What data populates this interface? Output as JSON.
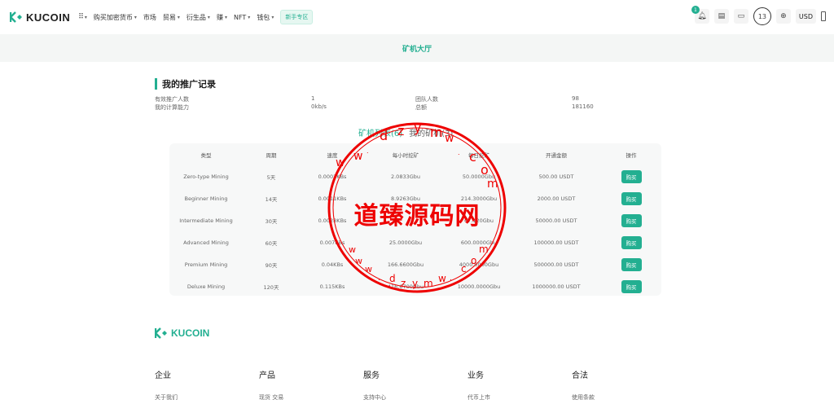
{
  "header": {
    "logo_text": "KUCOIN",
    "nav": [
      {
        "label": "购买加密货币",
        "dropdown": true
      },
      {
        "label": "市场",
        "dropdown": false
      },
      {
        "label": "贸易",
        "dropdown": true
      },
      {
        "label": "衍生品",
        "dropdown": true
      },
      {
        "label": "赚",
        "dropdown": true
      },
      {
        "label": "NFT",
        "dropdown": true
      },
      {
        "label": "钱包",
        "dropdown": true
      }
    ],
    "new_user_badge": "新手专区",
    "notification_count": "1",
    "profile_number": "13",
    "currency": "USD"
  },
  "page_title": "矿机大厅",
  "records": {
    "title": "我的推广记录",
    "stats": [
      {
        "label": "有效推广人数",
        "value": "1",
        "label2": "团队人数",
        "value2": "98"
      },
      {
        "label": "我的计算能力",
        "value": "0kb/s",
        "label2": "总额",
        "value2": "181160"
      }
    ]
  },
  "tabs": {
    "active": "矿机列表(6)",
    "inactive": "我的矿机(3)"
  },
  "table": {
    "headers": [
      "类型",
      "周期",
      "速度",
      "每小时挖矿",
      "每日挖矿",
      "开通金额",
      "操作"
    ],
    "rows": [
      [
        "Zero-type Mining",
        "5天",
        "0.0002KBs",
        "2.0833Gbu",
        "50.0000Gbu",
        "500.00 USDT",
        "购买"
      ],
      [
        "Beginner Mining",
        "14天",
        "0.0011KBs",
        "8.9263Gbu",
        "214.3000Gbu",
        "2000.00 USDT",
        "购买"
      ],
      [
        "Intermediate Mining",
        "30天",
        "0.0028KBs",
        "",
        "67.120Gbu",
        "50000.00 USDT",
        "购买"
      ],
      [
        "Advanced Mining",
        "60天",
        "0.007KBs",
        "25.0000Gbu",
        "600.0000Gbu",
        "100000.00 USDT",
        "购买"
      ],
      [
        "Premium Mining",
        "90天",
        "0.04KBs",
        "166.6600Gbu",
        "4000.0000Gbu",
        "500000.00 USDT",
        "购买"
      ],
      [
        "Deluxe Mining",
        "120天",
        "0.115KBs",
        "416.6700Gbu",
        "10000.0000Gbu",
        "1000000.00 USDT",
        "购买"
      ]
    ]
  },
  "watermark": {
    "center_text": "道臻源码网",
    "ring_text": "www.dzym.com"
  },
  "footer": {
    "logo_text": "KUCOIN",
    "columns": [
      {
        "title": "企业",
        "item": "关于我们"
      },
      {
        "title": "产品",
        "item": "现货 交易"
      },
      {
        "title": "服务",
        "item": "支持中心"
      },
      {
        "title": "业务",
        "item": "代币上市"
      },
      {
        "title": "合法",
        "item": "使用条款"
      }
    ]
  },
  "colors": {
    "accent": "#23af91",
    "stamp": "#e00000"
  }
}
